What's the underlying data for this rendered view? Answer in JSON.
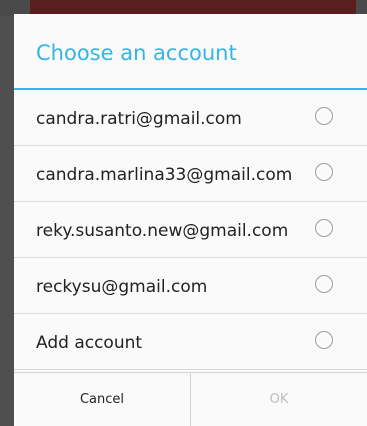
{
  "dialog": {
    "title": "Choose an account",
    "accounts": [
      {
        "label": "candra.ratri@gmail.com",
        "selected": false
      },
      {
        "label": "candra.marlina33@gmail.com",
        "selected": false
      },
      {
        "label": "reky.susanto.new@gmail.com",
        "selected": false
      },
      {
        "label": "reckysu@gmail.com",
        "selected": false
      },
      {
        "label": "Add account",
        "selected": false
      }
    ],
    "buttons": {
      "cancel": "Cancel",
      "ok": "OK"
    }
  },
  "colors": {
    "accent": "#33b5e5",
    "disabled_text": "#bdbdbd"
  }
}
